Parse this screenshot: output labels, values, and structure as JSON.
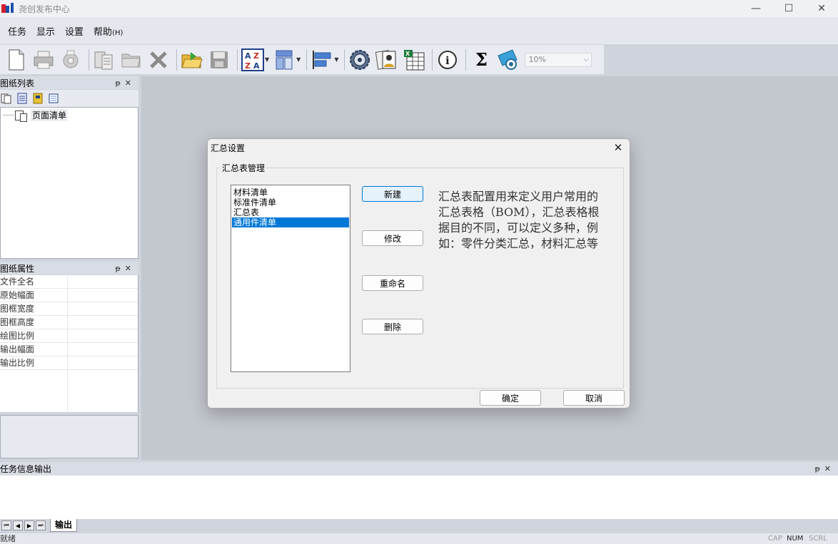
{
  "window": {
    "title": "尧创发布中心",
    "minimize": "—",
    "maximize": "☐",
    "close": "✕"
  },
  "menu": {
    "items": [
      "任务",
      "显示",
      "设置"
    ],
    "help_main": "帮助",
    "help_accel": "(H)"
  },
  "toolbar": {
    "zoom_value": "10%",
    "sum_glyph": "Σ"
  },
  "sheet_list": {
    "title": "图纸列表",
    "pin": "ᵽ",
    "close": "✕",
    "tree_item": "页面清单"
  },
  "sheet_props": {
    "title": "图纸属性",
    "pin": "ᵽ",
    "close": "✕",
    "rows": [
      "文件全名",
      "原始幅面",
      "图框宽度",
      "图框高度",
      "绘图比例",
      "输出幅面",
      "输出比例"
    ]
  },
  "output": {
    "title": "任务信息输出",
    "pin": "ᵽ",
    "close": "✕",
    "tab": "输出",
    "nav": [
      "⏮",
      "◀",
      "▶",
      "⏭"
    ]
  },
  "status": {
    "text": "就绪",
    "cap": "CAP",
    "num": "NUM",
    "scrl": "SCRL"
  },
  "dialog": {
    "title": "汇总设置",
    "close": "✕",
    "group_label": "汇总表管理",
    "list_items": [
      "材料清单",
      "标准件清单",
      "汇总表",
      "通用件清单"
    ],
    "selected_index": 3,
    "new_btn": "新建",
    "edit_btn": "修改",
    "rename_btn": "重命名",
    "delete_btn": "删除",
    "description": "汇总表配置用来定义用户常用的汇总表格（BOM），汇总表格根据目的不同，可以定义多种，例如：零件分类汇总，材料汇总等",
    "ok_btn": "确定",
    "cancel_btn": "取消"
  }
}
